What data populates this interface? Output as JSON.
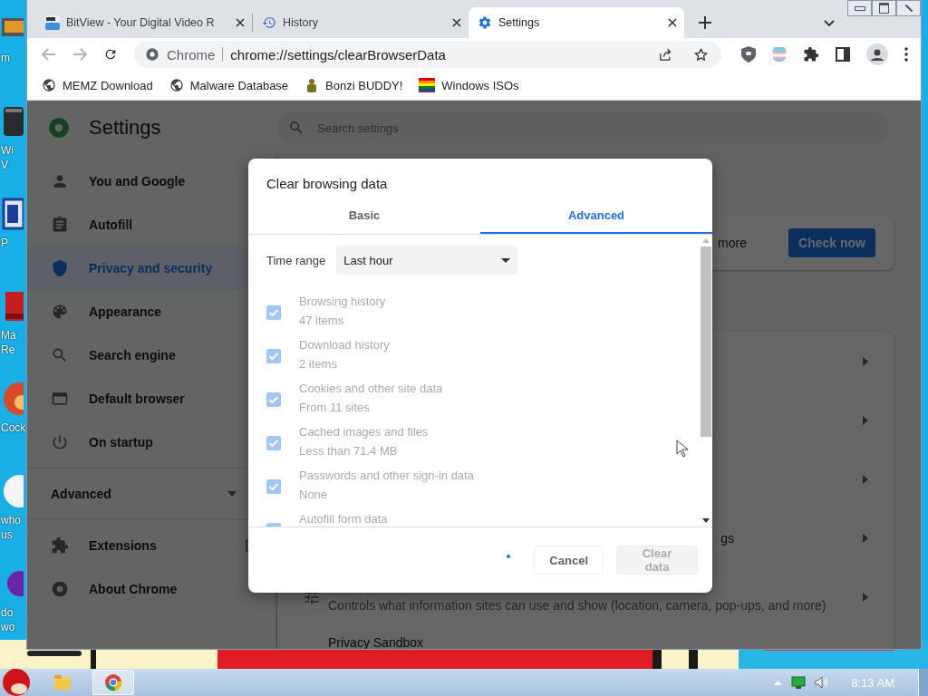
{
  "desktop": {
    "icons": [
      {
        "lines": [
          "m"
        ]
      },
      {
        "lines": [
          "Wi",
          "V"
        ]
      },
      {
        "lines": [
          "P"
        ]
      },
      {
        "lines": [
          "Ma",
          "Re"
        ]
      },
      {
        "lines": [
          "Cock"
        ]
      },
      {
        "lines": [
          "who",
          "us"
        ]
      },
      {
        "lines": [
          "do",
          "wo"
        ]
      }
    ]
  },
  "browser": {
    "tabs": [
      {
        "title": "BitView - Your Digital Video R",
        "selected": false
      },
      {
        "title": "History",
        "selected": false
      },
      {
        "title": "Settings",
        "selected": true
      }
    ],
    "omnibox": {
      "chip": "Chrome",
      "url": "chrome://settings/clearBrowserData"
    },
    "bookmarks": [
      {
        "label": "MEMZ Download"
      },
      {
        "label": "Malware Database"
      },
      {
        "label": "Bonzi BUDDY!"
      },
      {
        "label": "Windows ISOs"
      }
    ]
  },
  "settings": {
    "title": "Settings",
    "search_placeholder": "Search settings",
    "nav": [
      {
        "label": "You and Google",
        "selected": false
      },
      {
        "label": "Autofill",
        "selected": false
      },
      {
        "label": "Privacy and security",
        "selected": true
      },
      {
        "label": "Appearance",
        "selected": false
      },
      {
        "label": "Search engine",
        "selected": false
      },
      {
        "label": "Default browser",
        "selected": false
      },
      {
        "label": "On startup",
        "selected": false
      }
    ],
    "advanced": {
      "label": "Advanced",
      "expanded": false
    },
    "nav_bottom": [
      {
        "label": "Extensions",
        "external": true
      },
      {
        "label": "About Chrome",
        "external": false
      }
    ],
    "safety_check": {
      "text": "more",
      "button": "Check now"
    },
    "privacy_rows": [
      {
        "kind": "hidden"
      },
      {
        "kind": "hidden"
      },
      {
        "kind": "hidden"
      },
      {
        "kind": "partial",
        "text": "gs"
      },
      {
        "kind": "described",
        "description": "Controls what information sites can use and show (location, camera, pop-ups, and more)"
      },
      {
        "kind": "title",
        "text": "Privacy Sandbox"
      }
    ]
  },
  "dialog": {
    "title": "Clear browsing data",
    "tabs": [
      {
        "label": "Basic",
        "selected": false
      },
      {
        "label": "Advanced",
        "selected": true
      }
    ],
    "time_range": {
      "label": "Time range",
      "value": "Last hour"
    },
    "items": [
      {
        "title": "Browsing history",
        "detail": "47 items",
        "checked": true,
        "disabled": true
      },
      {
        "title": "Download history",
        "detail": "2 items",
        "checked": true,
        "disabled": true
      },
      {
        "title": "Cookies and other site data",
        "detail": "From 11 sites",
        "checked": true,
        "disabled": true
      },
      {
        "title": "Cached images and files",
        "detail": "Less than 71.4 MB",
        "checked": true,
        "disabled": true
      },
      {
        "title": "Passwords and other sign-in data",
        "detail": "None",
        "checked": true,
        "disabled": true
      },
      {
        "title": "Autofill form data",
        "checked": true,
        "disabled": true
      }
    ],
    "buttons": [
      {
        "label": "Cancel",
        "disabled": false
      },
      {
        "label": "Clear data",
        "disabled": true
      }
    ]
  },
  "taskbar": {
    "apps": [
      {
        "selected": false
      },
      {
        "selected": true
      }
    ],
    "clock": "8:13 AM"
  }
}
